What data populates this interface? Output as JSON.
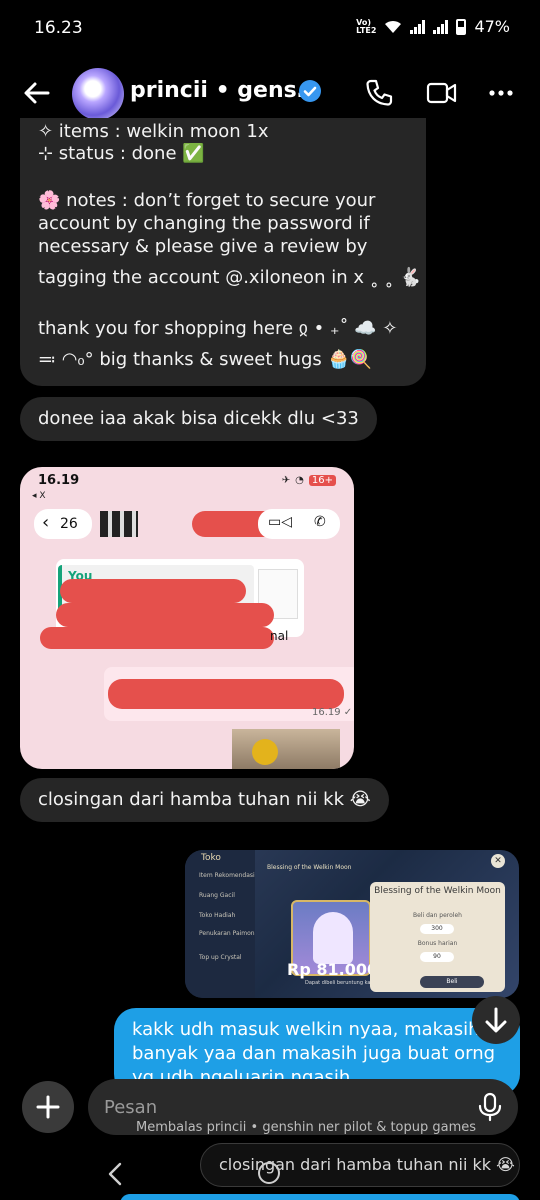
{
  "status_bar": {
    "time": "16.23",
    "network": "VoLTE2",
    "battery": "47%"
  },
  "header": {
    "title": "princii • gens…",
    "icons": {
      "back": "back-arrow-icon",
      "verified": "verified-badge-icon",
      "call": "phone-icon",
      "video": "video-icon",
      "more": "more-icon"
    }
  },
  "messages": {
    "long_message": {
      "line_cut": "✧ items : welkin moon 1x",
      "line_status": "⊹ status : done ✅",
      "line_notes_1": "🌸 notes : don’t forget to secure your",
      "line_notes_2": "account by changing the password if",
      "line_notes_3": "necessary & please give a review by",
      "line_notes_4": "tagging the account @.xiloneon in x ˳ ˳ 🐇",
      "line_thanks_1": "thank you for shopping here ჲ  • ₊˚ ☁️ ✧",
      "line_thanks_2": "≕ ◠₀° big thanks & sweet hugs 🧁🍭"
    },
    "msg_donee": "donee iaa akak bisa dicekk dlu <33",
    "msg_closingan": "closingan dari hamba tuhan nii kk 😭",
    "my_message": {
      "line_1": "kakk udh masuk welkin nyaa, makasih",
      "line_2": "banyak yaa dan makasih juga buat orng",
      "line_3": "yg udh ngeluarin ngasih"
    }
  },
  "screenshot_image": {
    "time": "16.19",
    "carrier": "◂ X",
    "battery": "16+",
    "back_count": "26",
    "quote_sender": "You",
    "partial_text": "nal",
    "timestamp": "16.19 ✓"
  },
  "game_image": {
    "shop": "Toko",
    "menu": [
      "Item Rekomendasi",
      "Ruang Gacil",
      "Toko Hadiah",
      "Penukaran Paimon",
      "Top up Crystal"
    ],
    "small_title": "Blessing of the Welkin Moon",
    "price": "Rp 81.000",
    "note": "Dapat dibeli beruntung kali",
    "panel_title": "Blessing of the Welkin Moon",
    "panel_label_1": "Beli dan peroleh",
    "panel_value_1": "300",
    "panel_label_2": "Bonus harian",
    "panel_value_2": "90",
    "buy": "Beli"
  },
  "composer": {
    "placeholder": "Pesan"
  },
  "reply_hint": "Membalas princii • genshin ner pilot & topup games",
  "bottom_preview": "closingan dari hamba tuhan nii kk 😭",
  "colors": {
    "bubble_other": "#262626",
    "bubble_mine": "#1e9fe6",
    "background": "#000000",
    "redaction": "#e5504c"
  }
}
